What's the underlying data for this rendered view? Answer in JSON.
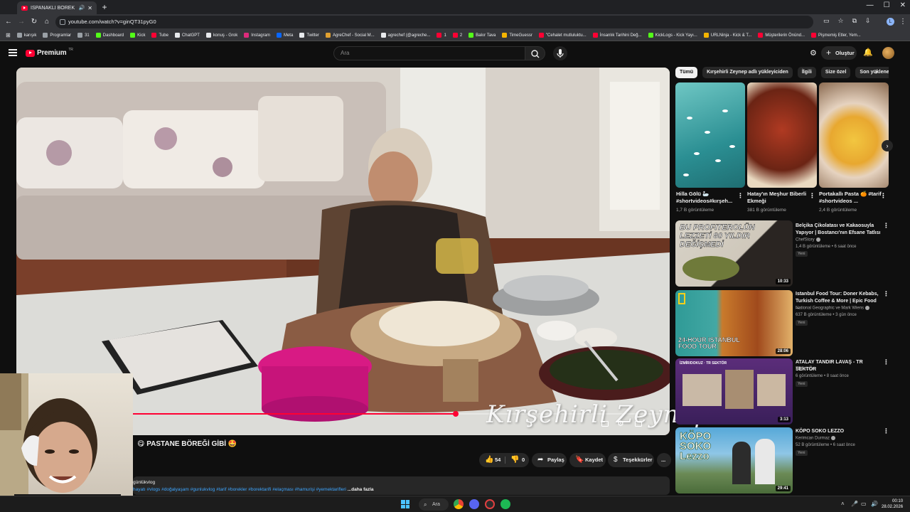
{
  "browser": {
    "tab_title": "ISPANAKLI BÖREK NASIL YA",
    "url": "youtube.com/watch?v=ginQT31pyG0",
    "profile_letter": "L"
  },
  "bookmarks": [
    {
      "label": "karışık",
      "color": "#9aa0a6"
    },
    {
      "label": "Programlar",
      "color": "#9aa0a6"
    },
    {
      "label": "31",
      "color": "#9aa0a6"
    },
    {
      "label": "Dashboard",
      "color": "#53fc18"
    },
    {
      "label": "Kick",
      "color": "#53fc18"
    },
    {
      "label": "Tube",
      "color": "#ff0033"
    },
    {
      "label": "ChatGPT",
      "color": "#e8eaed"
    },
    {
      "label": "konuş - Grok",
      "color": "#e8eaed"
    },
    {
      "label": "Instagram",
      "color": "#dd2a7b"
    },
    {
      "label": "Meta",
      "color": "#0866ff"
    },
    {
      "label": "Twitter",
      "color": "#e8eaed"
    },
    {
      "label": "AgreChef - Social M...",
      "color": "#e0a030"
    },
    {
      "label": "agrechef (@agreche...",
      "color": "#e8eaed"
    },
    {
      "label": "1",
      "color": "#ff0033"
    },
    {
      "label": "2",
      "color": "#ff0033"
    },
    {
      "label": "Bakır Tava",
      "color": "#53fc18"
    },
    {
      "label": "TimeGuessr",
      "color": "#f4b400"
    },
    {
      "label": "\"Cehalet mutluluktu...",
      "color": "#ff0033"
    },
    {
      "label": "İnsanlık Tarihini Değ...",
      "color": "#ff0033"
    },
    {
      "label": "KickLogs - Kick Yayı...",
      "color": "#53fc18"
    },
    {
      "label": "URLNinja - Kick & T...",
      "color": "#f4b400"
    },
    {
      "label": "Müşterilerin Önünd...",
      "color": "#ff0033"
    },
    {
      "label": "Pişmemiş Etler, Yem...",
      "color": "#ff0033"
    }
  ],
  "youtube": {
    "brand": "Premium",
    "country": "TR",
    "search_placeholder": "Ara",
    "create_label": "Oluştur"
  },
  "video": {
    "title": "😋 PASTANE BÖREĞİ GİBİ 🤩",
    "watermark": "Kırşehirli Zeynep",
    "progress": 0.61,
    "likes": "54",
    "dislikes": "0",
    "share_label": "Paylaş",
    "save_label": "Kaydet",
    "thanks_label": "Teşekkürler",
    "more_label": "...",
    "description_channel": "günlükvlog",
    "description_tags": "hayatı #vlogs #doğalyaşam #gunlukvlog #tarif #borekler #borektarifi #elaçması #hamurişi #yemektarifleri",
    "description_more": "...daha fazla"
  },
  "sidebar": {
    "chips": [
      "Tümü",
      "Kırşehirli Zeynep adlı yükleyiciden",
      "İlgili",
      "Size özel",
      "Son yüklenen"
    ],
    "shorts": [
      {
        "title": "Hilla Gölü 🦢 #shortvideos#kırşeh...",
        "views": "1,7 B görüntüleme"
      },
      {
        "title": "Hatay'ın Meşhur Biberli Ekmeği",
        "views": "381 B görüntüleme"
      },
      {
        "title": "Portakallı Pasta 🍊 #tarif #shortvideos ...",
        "views": "2,4 B görüntüleme"
      }
    ],
    "recommendations": [
      {
        "thumb_text": "BU PROFITEROLÜN LEZZETİ 80 YILDIR DEĞİŞMEDİ",
        "duration": "10:33",
        "title": "Belçika Çikolatası ve Kakaosuyla Yapıyor | Bostancı'nın Efsane Tatlısı",
        "channel": "ChefStory",
        "meta": "1,4 B görüntüleme • 6 saat önce",
        "badge": "Yeni"
      },
      {
        "thumb_text": "24-HOUR ISTANBUL FOOD TOUR",
        "duration": "28:06",
        "title": "Istanbul Food Tour: Doner Kebabs, Turkish Coffee & More | Epic Food ...",
        "channel": "National Geographic ve Mark Wiens",
        "meta": "637 B görüntüleme • 3 gün önce",
        "badge": "Yeni"
      },
      {
        "thumb_text": "İZMİR/DOKUZ · TR SEKTÖR",
        "duration": "3:13",
        "title": "ATALAY TANDIR LAVAŞ - TR SEKTÖR",
        "channel": "TRSektör",
        "meta": "6 görüntüleme • 8 saat önce",
        "badge": "Yeni"
      },
      {
        "thumb_text": "KÖPO SOKO Lezzo",
        "duration": "29:41",
        "title": "KÖPO SOKO LEZZO",
        "channel": "Kerimcan Durmaz",
        "meta": "52 B görüntüleme • 6 saat önce",
        "badge": "Yeni"
      }
    ]
  },
  "taskbar": {
    "search_label": "Ara",
    "time": "00:10",
    "date": "28.02.2026"
  },
  "colors": {
    "background": "#0f0f0f",
    "accent": "#ff0033",
    "link": "#3ea6ff"
  }
}
